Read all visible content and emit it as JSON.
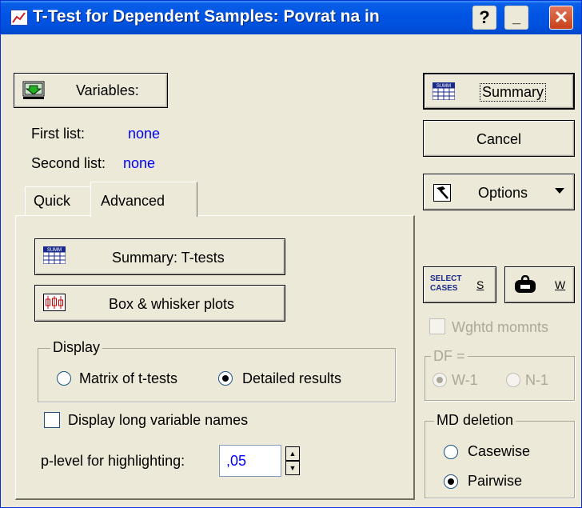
{
  "window": {
    "title": "T-Test for Dependent Samples: Povrat na in"
  },
  "titlebar": {
    "help": "?",
    "minimize": "_",
    "close": "✕"
  },
  "variables": {
    "button_label": "Variables:",
    "first_list_label": "First list:",
    "first_list_value": "none",
    "second_list_label": "Second list:",
    "second_list_value": "none"
  },
  "tabs": [
    {
      "label": "Quick"
    },
    {
      "label": "Advanced"
    }
  ],
  "advanced": {
    "summary_ttests_label": "Summary:  T-tests",
    "box_whisker_label": "Box & whisker plots",
    "display_group": "Display",
    "matrix_label": "Matrix of t-tests",
    "detailed_label": "Detailed results",
    "detailed_selected": true,
    "long_names_label": "Display long variable names",
    "long_names_checked": false,
    "plevel_label": "p-level for highlighting:",
    "plevel_value": ",05"
  },
  "right": {
    "summary_label": "Summary",
    "cancel_label": "Cancel",
    "options_label": "Options",
    "select_cases_icon_text": "SELECT CASES",
    "select_cases_label": "S",
    "weight_label": "W",
    "wghtd_label": "Wghtd momnts",
    "df_group": "DF =",
    "df_w1": "W-1",
    "df_n1": "N-1",
    "md_group": "MD deletion",
    "casewise_label": "Casewise",
    "pairwise_label": "Pairwise",
    "pairwise_selected": true
  },
  "icons": {
    "summary_icon_text": "SUMM"
  },
  "colors": {
    "title_blue": "#0054e3",
    "face": "#ece9d8",
    "value_blue": "#0000ff"
  }
}
